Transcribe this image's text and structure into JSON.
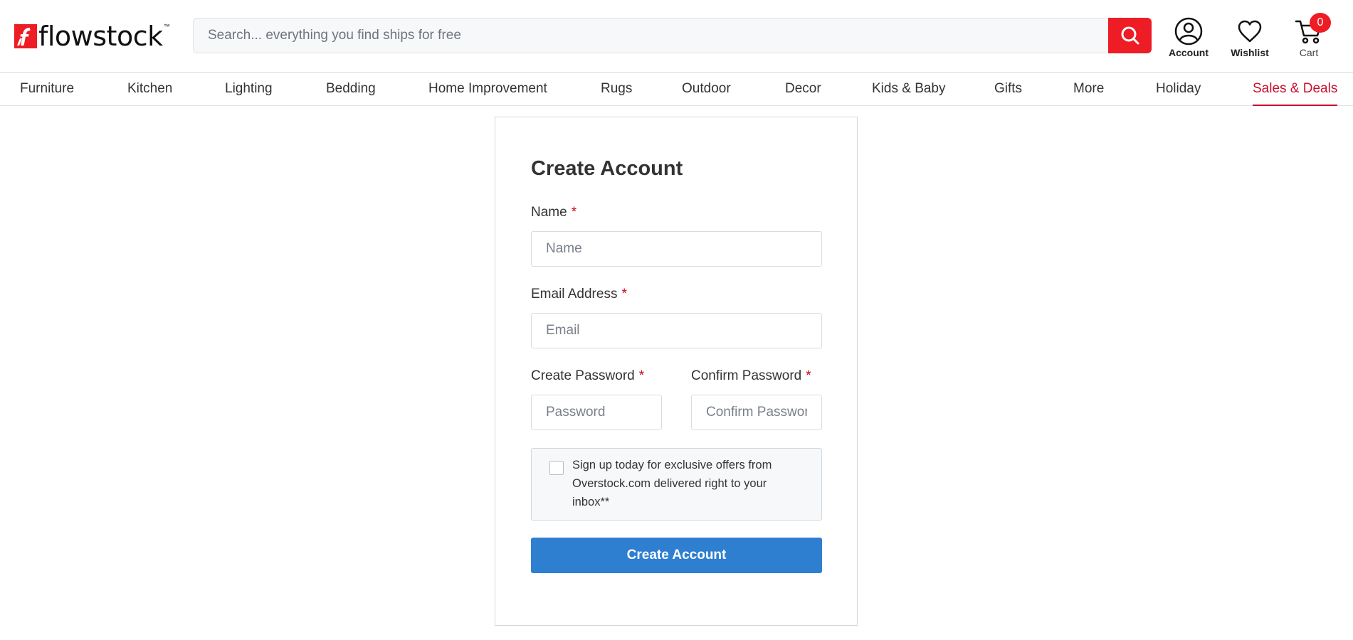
{
  "header": {
    "logo_text": "flowstock",
    "logo_tm": "™",
    "search": {
      "placeholder": "Search... everything you find ships for free",
      "value": ""
    },
    "account_label": "Account",
    "wishlist_label": "Wishlist",
    "cart_label": "Cart",
    "cart_count": "0"
  },
  "nav": {
    "items": [
      "Furniture",
      "Kitchen",
      "Lighting",
      "Bedding",
      "Home Improvement",
      "Rugs",
      "Outdoor",
      "Decor",
      "Kids & Baby",
      "Gifts",
      "More",
      "Holiday",
      "Sales & Deals"
    ],
    "active": "Sales & Deals"
  },
  "form": {
    "title": "Create Account",
    "required_mark": "*",
    "name": {
      "label": "Name",
      "placeholder": "Name",
      "value": ""
    },
    "email": {
      "label": "Email Address",
      "placeholder": "Email",
      "value": ""
    },
    "password": {
      "label": "Create Password",
      "placeholder": "Password",
      "value": ""
    },
    "confirm": {
      "label": "Confirm Password",
      "placeholder": "Confirm Password",
      "value": ""
    },
    "optin": {
      "text": "Sign up today for exclusive offers from Overstock.com delivered right to your inbox**",
      "checked": false
    },
    "submit_label": "Create Account"
  },
  "colors": {
    "brand_red": "#ee1c25",
    "nav_active": "#c8102e",
    "primary_button": "#2f7fd0",
    "required": "#d0021b"
  },
  "icons": [
    "search-icon",
    "account-icon",
    "heart-icon",
    "cart-icon"
  ]
}
